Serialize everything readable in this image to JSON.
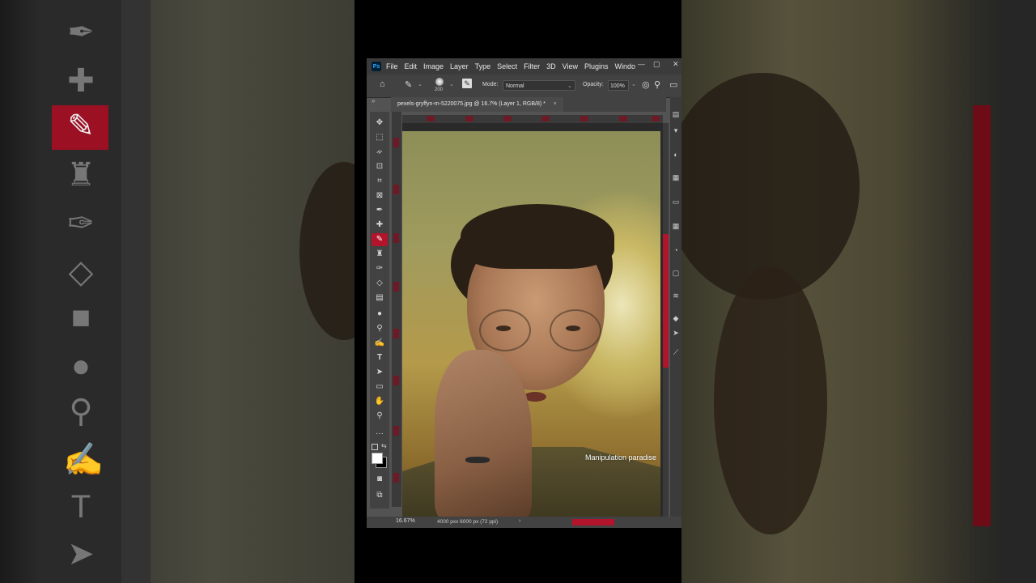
{
  "app": {
    "logo": "Ps"
  },
  "menubar": {
    "items": [
      "File",
      "Edit",
      "Image",
      "Layer",
      "Type",
      "Select",
      "Filter",
      "3D",
      "View",
      "Plugins",
      "Windo"
    ]
  },
  "options_bar": {
    "brush_size": "200",
    "mode_label": "Mode:",
    "mode_value": "Normal",
    "opacity_label": "Opacity:",
    "opacity_value": "100%"
  },
  "document": {
    "tab_title": "pexels-gryffyn-m-5220075.jpg @ 16.7% (Layer 1, RGB/8) *",
    "tab_close": "×",
    "tool_icons": [
      "move-icon",
      "marquee-icon",
      "lasso-icon",
      "object-select-icon",
      "crop-icon",
      "frame-icon",
      "eyedropper-icon",
      "healing-brush-icon",
      "brush-icon",
      "clone-stamp-icon",
      "history-brush-icon",
      "eraser-icon",
      "gradient-icon",
      "blur-icon",
      "dodge-icon",
      "pen-icon",
      "type-icon",
      "path-select-icon",
      "rectangle-icon",
      "hand-icon",
      "zoom-icon",
      "more-tools-icon"
    ],
    "watermark": "Manipulation paradise"
  },
  "status": {
    "zoom": "16.67%",
    "dimensions": "4000 pxx 6000 px (72 ppi)",
    "arrow": "›"
  },
  "colors": {
    "accent": "#b2142b",
    "panel": "#424242",
    "menubar": "#3b3b3b"
  }
}
